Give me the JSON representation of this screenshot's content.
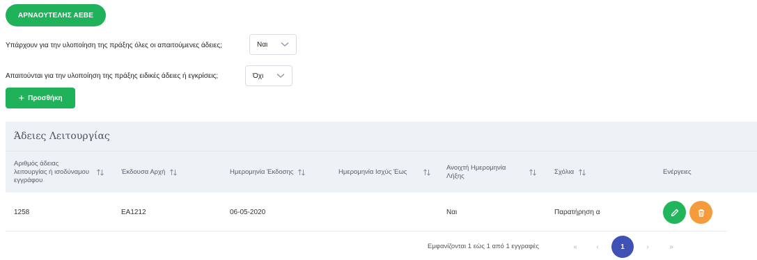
{
  "top_button": {
    "label": "ΑΡΝΑΟΥΤΕΛΗΣ ΑΕΒΕ"
  },
  "questions": [
    {
      "label": "Υπάρχουν για την υλοποίηση της πράξης όλες οι απαιτούμενες άδειες;",
      "value": "Ναι"
    },
    {
      "label": "Απαιτούνται για την υλοποίηση της πράξης ειδικές άδειες ή εγκρίσεις;",
      "value": "Όχι"
    }
  ],
  "add_button": {
    "label": "Προσθήκη",
    "icon": "plus-icon"
  },
  "table": {
    "title": "Άδειες Λειτουργίας",
    "columns": [
      "Αριθμός άδειας λειτουργίας ή ισοδύναμου εγγράφου",
      "Έκδουσα Αρχή",
      "Ημερομηνία Έκδοσης",
      "Ημερομηνία Ισχύς Έως",
      "Ανοιχτή Ημερομηνία Λήξης",
      "Σχόλια",
      "Ενέργειες"
    ],
    "rows": [
      {
        "number": "1258",
        "authority": "EA1212",
        "issue_date": "06-05-2020",
        "valid_until": "",
        "open_expiry": "Ναι",
        "comments": "Παρατήρηση α"
      }
    ]
  },
  "pagination": {
    "info": "Εμφανίζονται 1 εώς 1 από 1 εγγραφές",
    "first": "«",
    "prev": "‹",
    "current": "1",
    "next": "›",
    "last": "»"
  },
  "colors": {
    "green": "#20b25a",
    "orange": "#f69b3b",
    "indigo": "#3f51b5",
    "header_bg": "#eef1f5"
  }
}
